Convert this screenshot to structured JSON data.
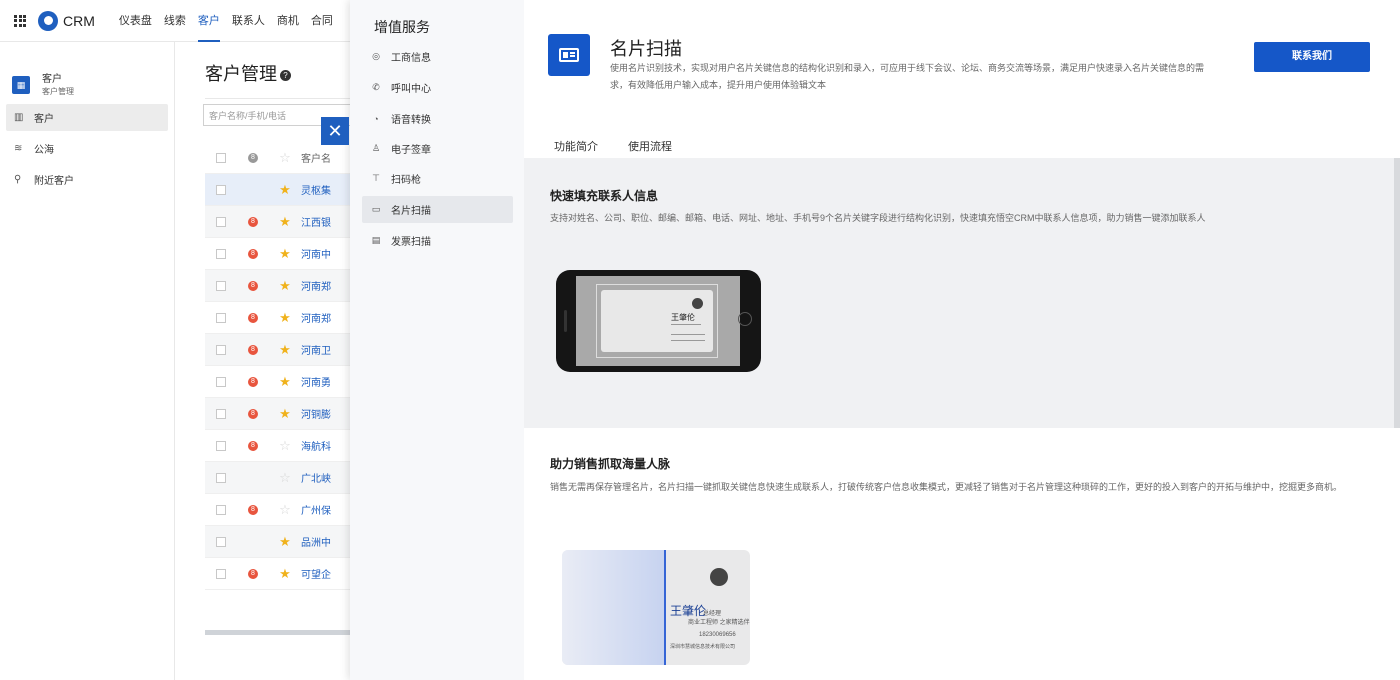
{
  "topnav": {
    "brand": "CRM",
    "items": [
      {
        "label": "仪表盘",
        "active": false
      },
      {
        "label": "线索",
        "active": false
      },
      {
        "label": "客户",
        "active": true
      },
      {
        "label": "联系人",
        "active": false
      },
      {
        "label": "商机",
        "active": false
      },
      {
        "label": "合同",
        "active": false
      }
    ]
  },
  "sidebar": {
    "title": "客户",
    "subtitle": "客户管理",
    "items": [
      {
        "label": "客户",
        "icon": "building-icon"
      },
      {
        "label": "公海",
        "icon": "waves-icon"
      },
      {
        "label": "附近客户",
        "icon": "location-pin-icon"
      }
    ]
  },
  "listing": {
    "title": "客户管理",
    "search_placeholder": "客户名称/手机/电话",
    "column_header": "客户名",
    "rows": [
      {
        "name": "灵枢集",
        "dot": "",
        "star": "★"
      },
      {
        "name": "江西银",
        "dot": "8",
        "star": "★"
      },
      {
        "name": "河南中",
        "dot": "8",
        "star": "★"
      },
      {
        "name": "河南郑",
        "dot": "8",
        "star": "★"
      },
      {
        "name": "河南郑",
        "dot": "8",
        "star": "★"
      },
      {
        "name": "河南卫",
        "dot": "8",
        "star": "★"
      },
      {
        "name": "河南勇",
        "dot": "8",
        "star": "★"
      },
      {
        "name": "河铜膨",
        "dot": "8",
        "star": "★"
      },
      {
        "name": "海航科",
        "dot": "8",
        "star": "☆"
      },
      {
        "name": "广北峡",
        "dot": "",
        "star": "☆"
      },
      {
        "name": "广州保",
        "dot": "8",
        "star": "☆"
      },
      {
        "name": "品洲中",
        "dot": "",
        "star": "★"
      },
      {
        "name": "可望企",
        "dot": "8",
        "star": "★"
      }
    ]
  },
  "services": {
    "title": "增值服务",
    "items": [
      {
        "label": "工商信息",
        "icon": "coin-icon"
      },
      {
        "label": "呼叫中心",
        "icon": "phone-icon"
      },
      {
        "label": "语音转换",
        "icon": "voice-icon"
      },
      {
        "label": "电子签章",
        "icon": "stamp-icon"
      },
      {
        "label": "扫码枪",
        "icon": "scanner-icon"
      },
      {
        "label": "名片扫描",
        "icon": "card-icon"
      },
      {
        "label": "发票扫描",
        "icon": "invoice-icon"
      }
    ]
  },
  "main": {
    "title": "名片扫描",
    "description": "使用名片识别技术，实现对用户名片关键信息的结构化识别和录入，可应用于线下会议、论坛、商务交流等场景，满足用户快速录入名片关键信息的需求，有效降低用户输入成本，提升用户使用体验辑文本",
    "contact_button": "联系我们",
    "tabs": [
      "功能简介",
      "使用流程"
    ],
    "section1_title": "快速填充联系人信息",
    "section1_desc": "支持对姓名、公司、职位、邮编、邮箱、电话、网址、地址、手机号9个名片关键字段进行结构化识别，快速填充悟空CRM中联系人信息项，助力销售一键添加联系人",
    "section2_title": "助力销售抓取海量人脉",
    "section2_desc": "销售无需再保存管理名片，名片扫描一键抓取关键信息快速生成联系人，打破传统客户信息收集模式，更减轻了销售对于名片管理这种琐碎的工作，更好的投入到客户的开拓与维护中，挖掘更多商机。",
    "card_name": "王肇伦",
    "card_title": "总经理",
    "card_line1": "商业工程师 之家精选伴",
    "card_phone": "18230069656",
    "card_addr": "深圳市慧城信息技术有限公司"
  },
  "colors": {
    "accent": "#1557c8",
    "nav_accent": "#1f5fbf",
    "star": "#f0b21c",
    "badge": "#e8553e"
  }
}
